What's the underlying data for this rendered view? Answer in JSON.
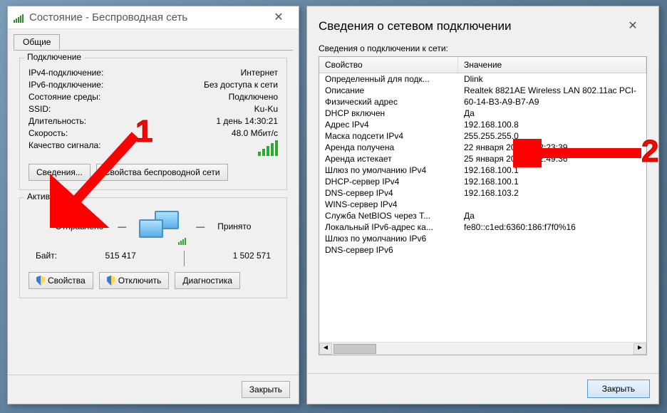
{
  "status_window": {
    "title": "Состояние - Беспроводная сеть",
    "tab_general": "Общие",
    "group_connection": "Подключение",
    "rows": {
      "ipv4_label": "IPv4-подключение:",
      "ipv4_value": "Интернет",
      "ipv6_label": "IPv6-подключение:",
      "ipv6_value": "Без доступа к сети",
      "media_label": "Состояние среды:",
      "media_value": "Подключено",
      "ssid_label": "SSID:",
      "ssid_value": "Ku-Ku",
      "duration_label": "Длительность:",
      "duration_value": "1 день 14:30:21",
      "speed_label": "Скорость:",
      "speed_value": "48.0 Мбит/с",
      "quality_label": "Качество сигнала:"
    },
    "btn_details": "Сведения...",
    "btn_wireless_props": "Свойства беспроводной сети",
    "group_activity": "Активность",
    "sent_label": "Отправлено",
    "recv_label": "Принято",
    "bytes_label": "Байт:",
    "bytes_sent": "515 417",
    "bytes_recv": "1 502 571",
    "btn_properties": "Свойства",
    "btn_disable": "Отключить",
    "btn_diagnose": "Диагностика",
    "btn_close": "Закрыть"
  },
  "details_window": {
    "title": "Сведения о сетевом подключении",
    "subtitle": "Сведения о подключении к сети:",
    "col_property": "Свойство",
    "col_value": "Значение",
    "rows": [
      {
        "p": "Определенный для подк...",
        "v": "Dlink"
      },
      {
        "p": "Описание",
        "v": "Realtek 8821AE Wireless LAN 802.11ac PCI-"
      },
      {
        "p": "Физический адрес",
        "v": "60-14-B3-A9-B7-A9"
      },
      {
        "p": "DHCP включен",
        "v": "Да"
      },
      {
        "p": "Адрес IPv4",
        "v": "192.168.100.8"
      },
      {
        "p": "Маска подсети IPv4",
        "v": "255.255.255.0"
      },
      {
        "p": "Аренда получена",
        "v": "22 января 2019 г. 22:23:39"
      },
      {
        "p": "Аренда истекает",
        "v": "25 января 2019 г. 12:49:36"
      },
      {
        "p": "Шлюз по умолчанию IPv4",
        "v": "192.168.100.1"
      },
      {
        "p": "DHCP-сервер IPv4",
        "v": "192.168.100.1"
      },
      {
        "p": "DNS-сервер IPv4",
        "v": "192.168.103.2"
      },
      {
        "p": "WINS-сервер IPv4",
        "v": ""
      },
      {
        "p": "Служба NetBIOS через T...",
        "v": "Да"
      },
      {
        "p": "Локальный IPv6-адрес ка...",
        "v": "fe80::c1ed:6360:186:f7f0%16"
      },
      {
        "p": "Шлюз по умолчанию IPv6",
        "v": ""
      },
      {
        "p": "DNS-сервер IPv6",
        "v": ""
      }
    ],
    "btn_close": "Закрыть"
  },
  "annotations": {
    "num1": "1",
    "num2": "2"
  }
}
